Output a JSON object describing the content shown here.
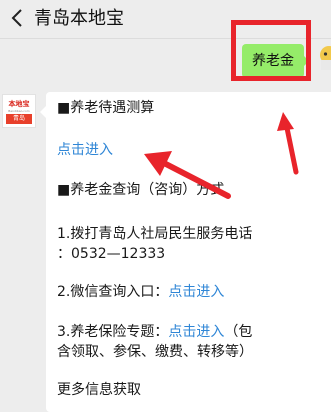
{
  "header": {
    "title": "青岛本地宝",
    "back_icon": "chevron-left-icon"
  },
  "sent_message": {
    "text": "养老金"
  },
  "sender": {
    "avatar_top": "本地宝",
    "avatar_mid": "Bendibao.com",
    "avatar_bottom": "青岛"
  },
  "message": {
    "section1_title": "■养老待遇测算",
    "section1_link": "点击进入",
    "section2_title": "■养老金查询（咨询）方式",
    "item1_line1": "1.拨打青岛人社局民生服务电话",
    "item1_line2": "：0532—12333",
    "item2_prefix": "2.微信查询入口：",
    "item2_link": "点击进入",
    "item3_prefix": "3.养老保险专题：",
    "item3_link": "点击进入",
    "item3_suffix": "（包",
    "item3_line2": "含领取、参保、缴费、转移等）",
    "more": "更多信息获取"
  },
  "annotation": {
    "color": "#e8242b"
  }
}
